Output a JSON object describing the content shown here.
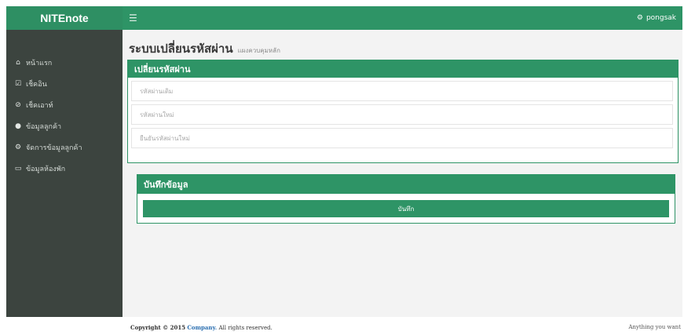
{
  "brand": {
    "name": "NITEnote"
  },
  "topbar": {
    "menu_icon": "hamburger-icon",
    "user_icon": "gear-icon",
    "username": "pongsak"
  },
  "sidebar": {
    "items": [
      {
        "icon": "home-icon",
        "glyph": "🏠",
        "label": "หน้าแรก"
      },
      {
        "icon": "checkin-icon",
        "glyph": "☑",
        "label": "เช็คอิน"
      },
      {
        "icon": "checkout-icon",
        "glyph": "⊘",
        "label": "เช็คเอาท์"
      },
      {
        "icon": "user-icon",
        "glyph": "👤",
        "label": "ข้อมูลลูกค้า"
      },
      {
        "icon": "settings-icon",
        "glyph": "⚙",
        "label": "จัดการข้อมูลลูกค้า"
      },
      {
        "icon": "monitor-icon",
        "glyph": "🖵",
        "label": "ข้อมูลห้องพัก"
      }
    ]
  },
  "page": {
    "title": "ระบบเปลี่ยนรหัสผ่าน",
    "subtitle": "แผงควบคุมหลัก"
  },
  "password_panel": {
    "title": "เปลี่ยนรหัสผ่าน",
    "old_placeholder": "รหัสผ่านเดิม",
    "new_placeholder": "รหัสผ่านใหม่",
    "confirm_placeholder": "ยืนยันรหัสผ่านใหม่"
  },
  "save_panel": {
    "title": "บันทึกข้อมูล",
    "button_label": "บันทึก"
  },
  "footer": {
    "copyright_prefix": "Copyright © 2015",
    "company": "Company.",
    "rights": "All rights reserved.",
    "right_text": "Anything you want"
  },
  "colors": {
    "accent": "#2e9466",
    "sidebar": "#3c443f",
    "content_bg": "#f3f3f3"
  }
}
